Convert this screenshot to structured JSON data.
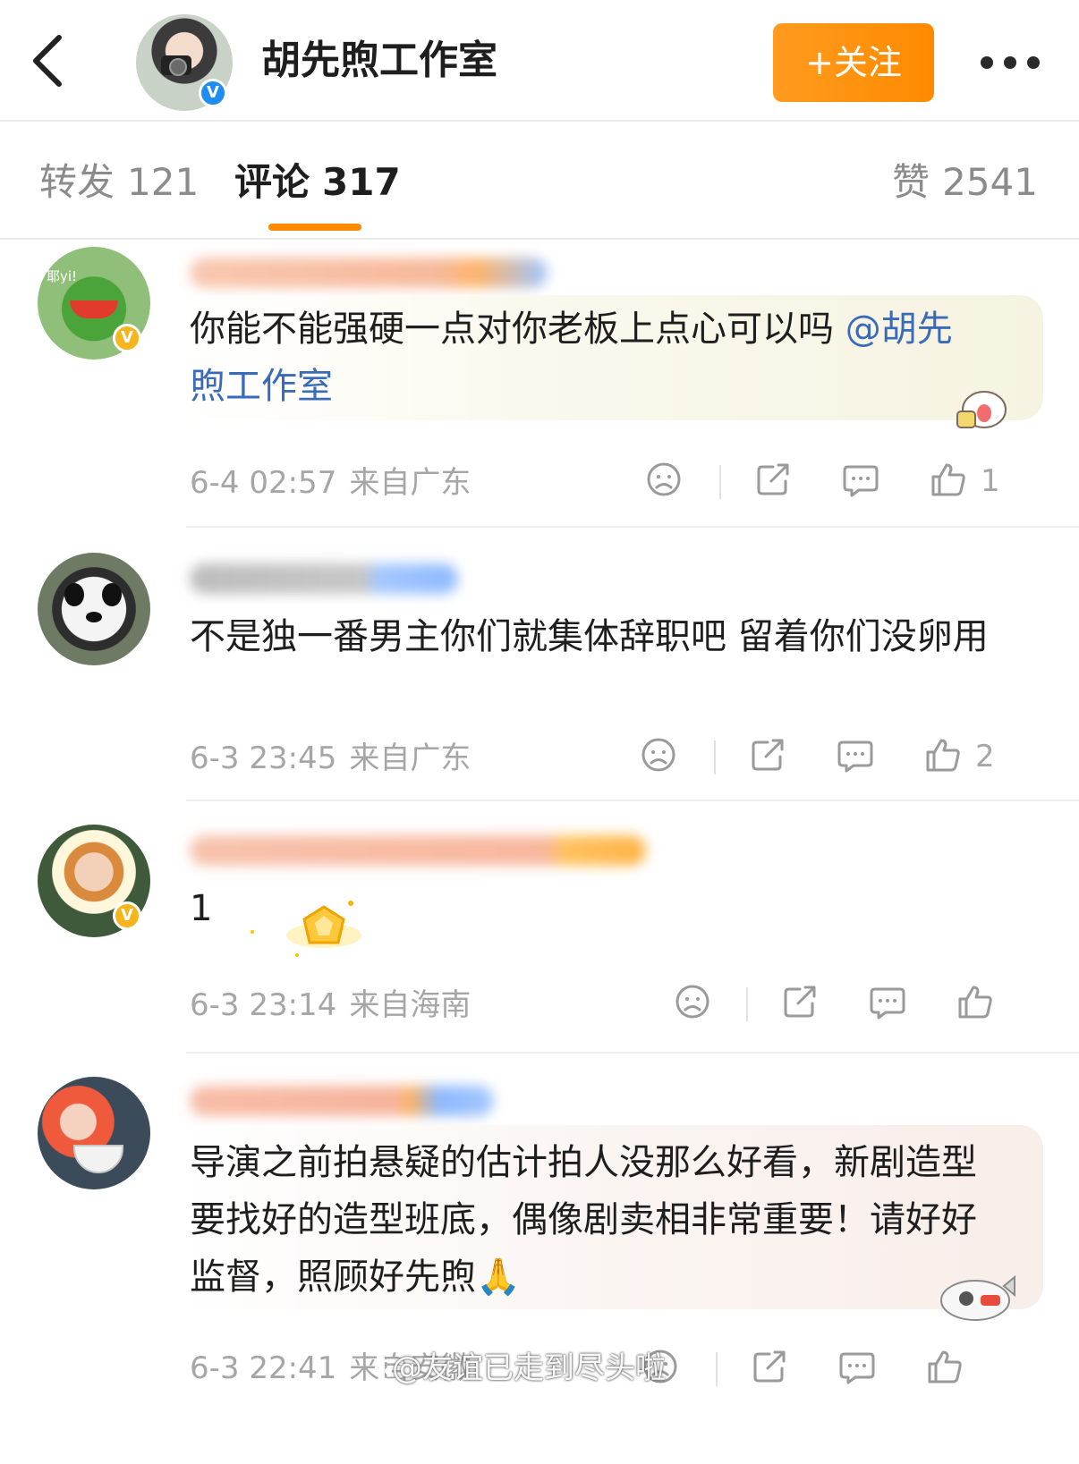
{
  "header": {
    "back_icon": "chevron-left-icon",
    "title": "胡先煦工作室",
    "follow_label": "+关注",
    "more_icon": "more-dots-icon",
    "verified_badge": "V"
  },
  "tabs": {
    "repost": {
      "label": "转发",
      "count": "121"
    },
    "comment": {
      "label": "评论",
      "count": "317"
    },
    "like": {
      "label": "赞",
      "count": "2541"
    },
    "accent": "#ff8a00"
  },
  "comments": [
    {
      "text_before_mention": "你能不能强硬一点对你老板上点心可以吗 ",
      "mention": "@胡先煦工作室",
      "date": "6-4 02:57",
      "location": "来自广东",
      "likes": "1",
      "avatar_badge": "V"
    },
    {
      "text": "不是独一番男主你们就集体辞职吧 留着你们没卵用",
      "date": "6-3 23:45",
      "location": "来自广东",
      "likes": "2"
    },
    {
      "text": "1",
      "date": "6-3 23:14",
      "location": "来自海南",
      "likes": "",
      "avatar_badge": "V"
    },
    {
      "text": "导演之前拍悬疑的估计拍人没那么好看，新剧造型要找好的造型班底，偶像剧卖相非常重要！请好好监督，照顾好先煦🙏",
      "date": "6-3 22:41",
      "location": "来自安徽"
    }
  ],
  "action_icons": [
    "dislike-icon",
    "share-icon",
    "reply-icon",
    "like-icon"
  ],
  "avatar1_text": "耶yi!",
  "watermark": "@友谊已走到尽头啦"
}
